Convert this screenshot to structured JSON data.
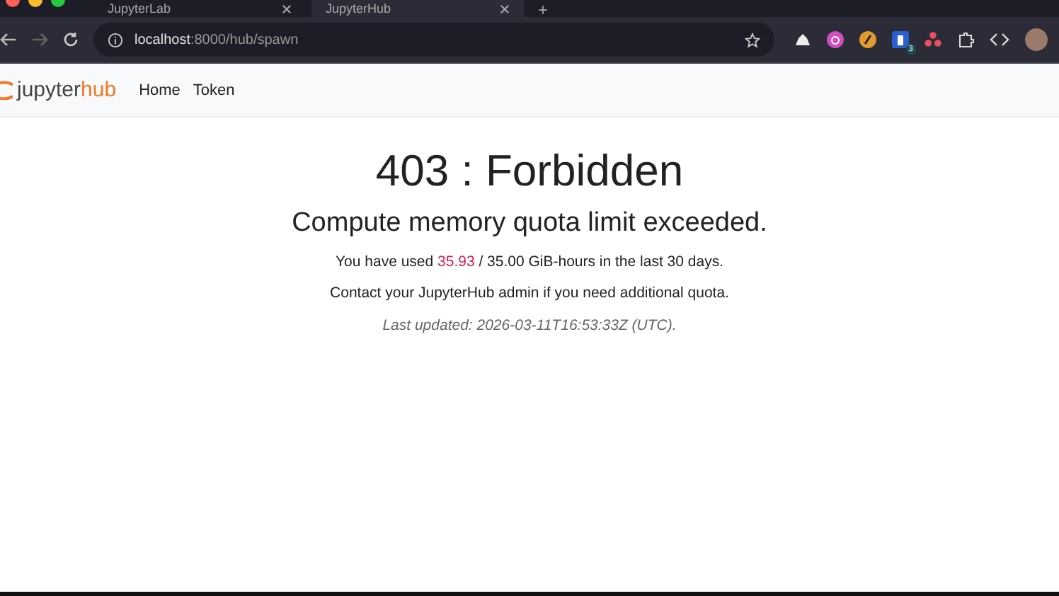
{
  "browser": {
    "tabs": [
      {
        "label": "JupyterLab",
        "selected": false
      },
      {
        "label": "JupyterHub",
        "selected": true
      }
    ],
    "new_tab": "+",
    "address": {
      "host": "localhost",
      "rest": ":8000/hub/spawn"
    },
    "extension_badge": "3"
  },
  "navbar": {
    "logo": {
      "part1": "jupyter",
      "part2": "hub"
    },
    "links": [
      {
        "label": "Home"
      },
      {
        "label": "Token"
      }
    ]
  },
  "error": {
    "title": "403 : Forbidden",
    "message": "Compute memory quota limit exceeded.",
    "usage": {
      "before": "You have used",
      "used": "35.93",
      "after": "/ 35.00 GiB-hours in the last 30 days."
    },
    "contact": "Contact your JupyterHub admin if you need additional quota.",
    "updated": "Last updated: 2026-03-11T16:53:33Z (UTC)."
  }
}
